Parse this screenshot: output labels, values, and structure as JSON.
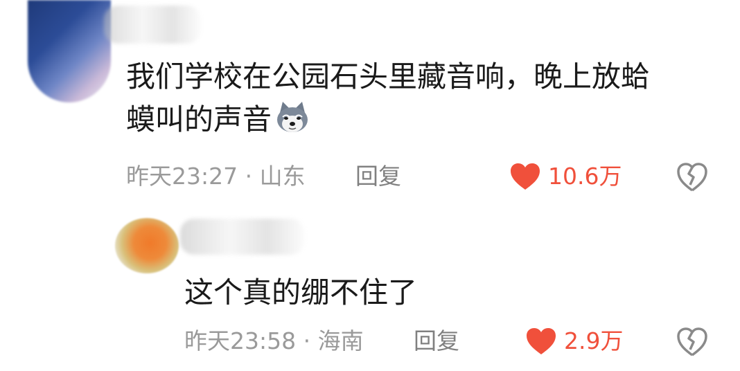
{
  "comments": [
    {
      "text_line1": "我们学校在公园石头里藏音响，晚上放蛤",
      "text_line2": "蟆叫的声音",
      "emoji": "husky-emoji",
      "meta": "昨天23:27 · 山东",
      "reply_label": "回复",
      "like_count": "10.6万"
    },
    {
      "text_line1": "这个真的绷不住了",
      "meta": "昨天23:58 · 海南",
      "reply_label": "回复",
      "like_count": "2.9万"
    }
  ],
  "icons": {
    "like": "heart-icon",
    "dislike": "broken-heart-icon"
  },
  "colors": {
    "like_active": "#f0503b",
    "meta_text": "#9a9a9a",
    "body_text": "#1a1a1a"
  }
}
